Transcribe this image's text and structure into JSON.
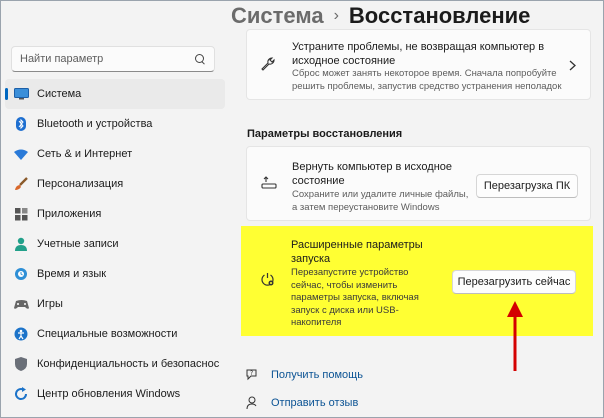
{
  "header": {
    "parent": "Система",
    "separator": "›",
    "title": "Восстановление"
  },
  "search": {
    "placeholder": "Найти параметр"
  },
  "nav": [
    {
      "label": "Система",
      "icon": "monitor-icon"
    },
    {
      "label": "Bluetooth и устройства",
      "icon": "bluetooth-icon"
    },
    {
      "label": "Сеть & и Интернет",
      "icon": "wifi-icon"
    },
    {
      "label": "Персонализация",
      "icon": "brush-icon"
    },
    {
      "label": "Приложения",
      "icon": "apps-icon"
    },
    {
      "label": "Учетные записи",
      "icon": "person-icon"
    },
    {
      "label": "Время и язык",
      "icon": "globe-clock-icon"
    },
    {
      "label": "Игры",
      "icon": "gamepad-icon"
    },
    {
      "label": "Специальные возможности",
      "icon": "accessibility-icon"
    },
    {
      "label": "Конфиденциальность и безопаснос",
      "icon": "shield-icon"
    },
    {
      "label": "Центр обновления Windows",
      "icon": "update-icon"
    }
  ],
  "troubleshoot": {
    "title_line1": "Устраните проблемы, не возвращая компьютер в",
    "title_line2": "исходное состояние",
    "desc_line1": "Сброс может занять некоторое время. Сначала попробуйте",
    "desc_line2": "решить проблемы, запустив средство устранения неполадок"
  },
  "section_label": "Параметры восстановления",
  "reset": {
    "title_line1": "Вернуть компьютер в исходное",
    "title_line2": "состояние",
    "desc_line1": "Сохраните или удалите личные файлы,",
    "desc_line2": "а затем переустановите Windows",
    "button": "Перезагрузка ПК"
  },
  "advanced": {
    "title_line1": "Расширенные параметры",
    "title_line2": "запуска",
    "desc_lines": [
      "Перезапустите устройство",
      "сейчас, чтобы изменить",
      "параметры запуска, включая",
      "запуск с диска или USB-",
      "накопителя"
    ],
    "button": "Перезагрузить сейчас"
  },
  "links": {
    "help": "Получить помощь",
    "feedback": "Отправить отзыв"
  },
  "colors": {
    "highlight": "#ffff33",
    "accent": "#0067c0",
    "arrow": "#d40000"
  }
}
